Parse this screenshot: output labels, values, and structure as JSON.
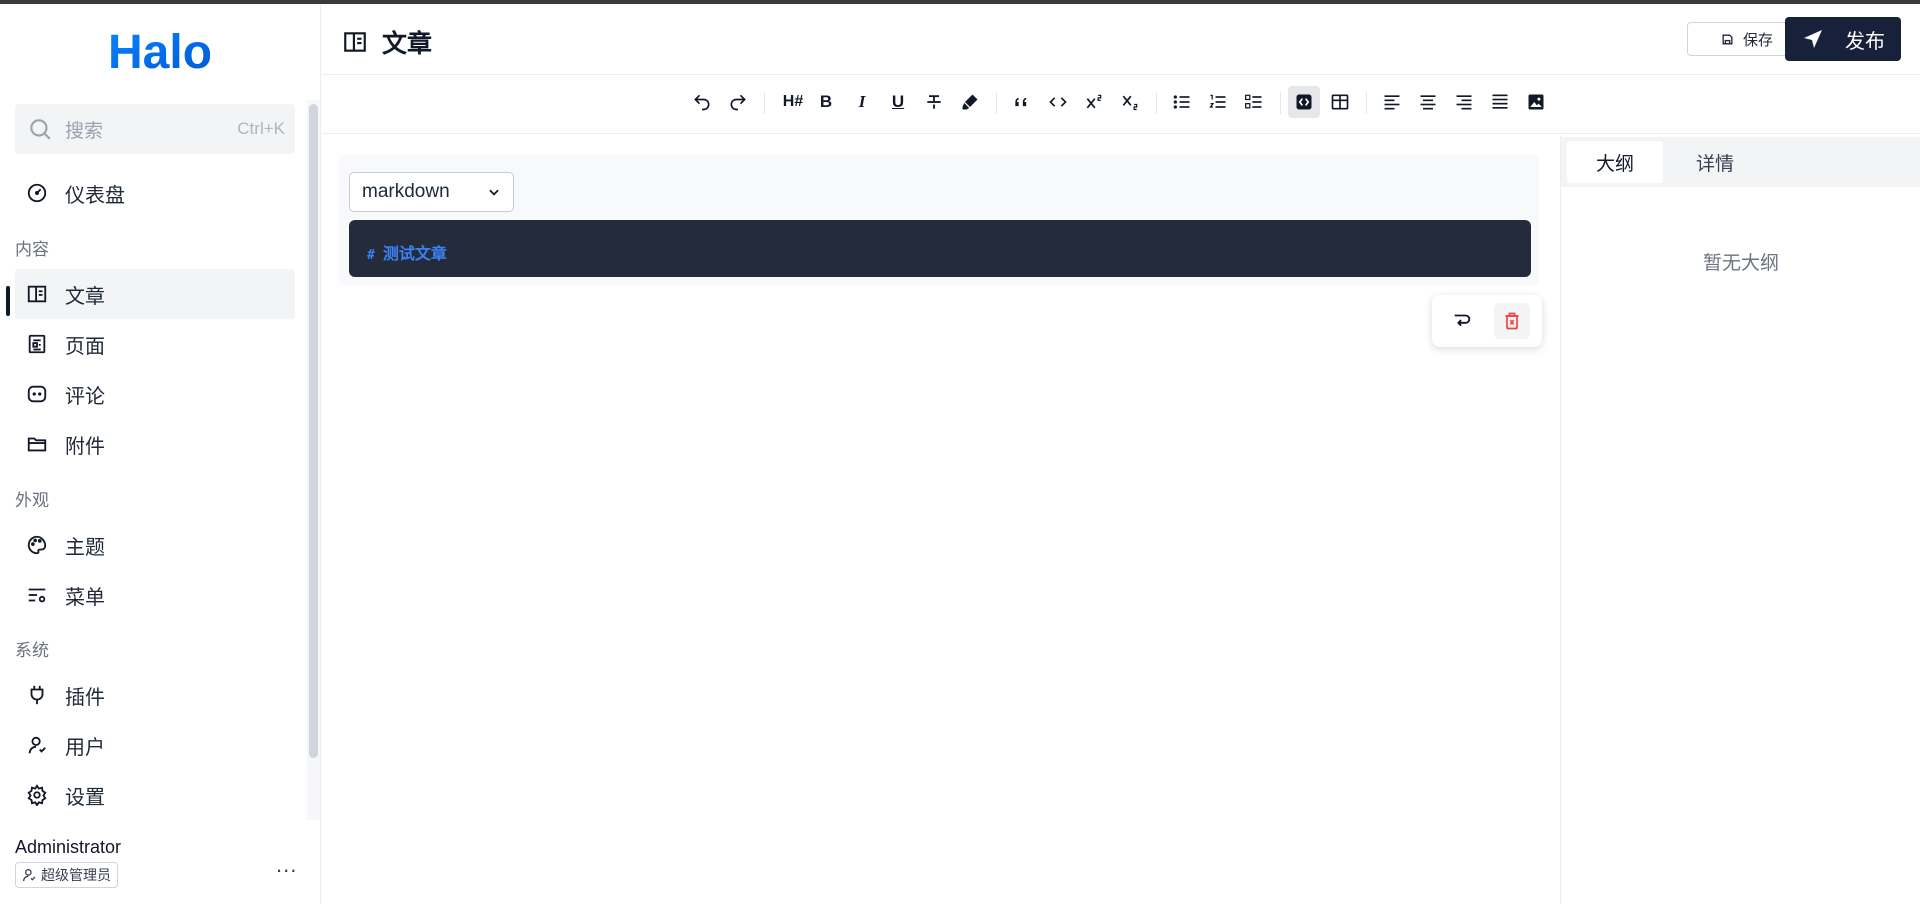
{
  "app": {
    "logo_text": "Halo"
  },
  "sidebar": {
    "search": {
      "placeholder": "搜索",
      "shortcut": "Ctrl+K"
    },
    "items": [
      {
        "label": "仪表盘",
        "icon": "dashboard-icon"
      },
      {
        "group": "内容"
      },
      {
        "label": "文章",
        "icon": "article-icon",
        "active": true
      },
      {
        "label": "页面",
        "icon": "page-icon"
      },
      {
        "label": "评论",
        "icon": "comment-icon"
      },
      {
        "label": "附件",
        "icon": "folder-icon"
      },
      {
        "group": "外观"
      },
      {
        "label": "主题",
        "icon": "palette-icon"
      },
      {
        "label": "菜单",
        "icon": "menu-settings-icon"
      },
      {
        "group": "系统"
      },
      {
        "label": "插件",
        "icon": "plug-icon"
      },
      {
        "label": "用户",
        "icon": "user-icon"
      },
      {
        "label": "设置",
        "icon": "gear-icon"
      }
    ],
    "user": {
      "name": "Administrator",
      "role": "超级管理员",
      "more": "..."
    }
  },
  "header": {
    "title": "文章",
    "save_label": "保存",
    "publish_label": "发布"
  },
  "toolbar": {
    "buttons": [
      "undo",
      "redo",
      "heading",
      "bold",
      "italic",
      "underline",
      "strikethrough",
      "highlight",
      "blockquote",
      "code",
      "superscript",
      "subscript",
      "bullet-list",
      "ordered-list",
      "task-list",
      "code-block",
      "table",
      "align-left",
      "align-center",
      "align-right",
      "align-justify",
      "image"
    ],
    "active": "code-block",
    "heading_label": "H#",
    "bold_label": "B",
    "italic_label": "I",
    "underline_label": "U"
  },
  "editor": {
    "language": "markdown",
    "code_hash": "#",
    "code_text": "测试文章"
  },
  "right_panel": {
    "tabs": [
      {
        "label": "大纲",
        "active": true
      },
      {
        "label": "详情"
      }
    ],
    "empty_text": "暂无大纲"
  },
  "colors": {
    "primary_dark": "#18213a",
    "brand_blue": "#1677ff",
    "code_bg": "#242b3a",
    "code_text": "#3b82f6",
    "danger": "#ef4444"
  }
}
